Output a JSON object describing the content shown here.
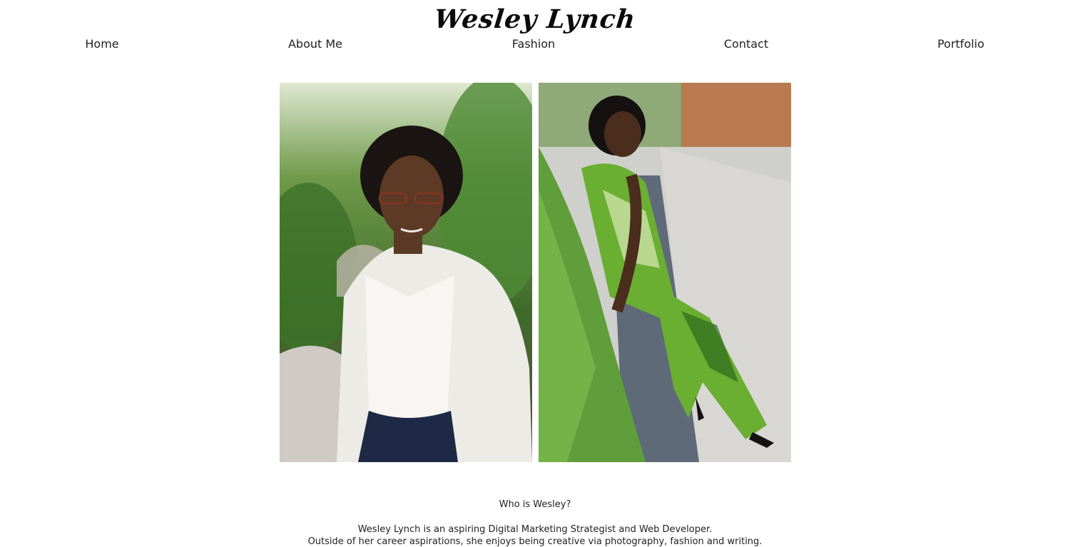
{
  "site": {
    "title": "Wesley Lynch"
  },
  "nav": {
    "items": [
      {
        "label": "Home"
      },
      {
        "label": "About Me"
      },
      {
        "label": "Fashion"
      },
      {
        "label": "Contact"
      },
      {
        "label": "Portfolio"
      }
    ]
  },
  "gallery": {
    "photos": [
      {
        "subject": "portrait-white-blazer"
      },
      {
        "subject": "portrait-green-jumpsuit"
      }
    ]
  },
  "about": {
    "heading": "Who is Wesley?",
    "line1": "Wesley Lynch is an aspiring Digital Marketing Strategist and Web Developer.",
    "line2": "Outside of her career aspirations, she enjoys being creative via photography, fashion and writing."
  },
  "colors": {
    "background": "#ffffff",
    "text": "#222222",
    "title": "#0b0b0b"
  }
}
